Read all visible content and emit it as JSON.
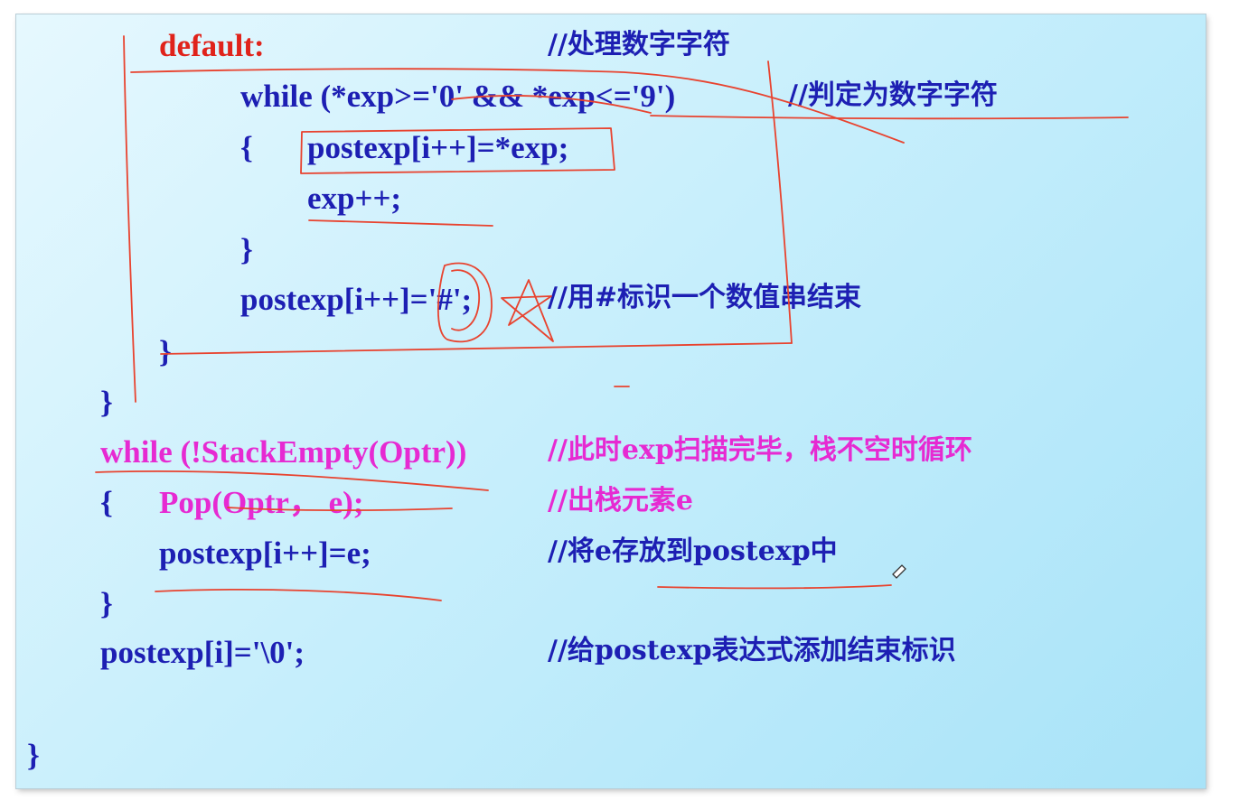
{
  "code_lines": {
    "default_label": "default:",
    "while_digit": "while (*exp>='0' && *exp<='9')",
    "brace_open_1": "{",
    "assign_exp": "postexp[i++]=*exp;",
    "exp_inc": "exp++;",
    "brace_close_1": "}",
    "assign_hash": "postexp[i++]='#';",
    "brace_close_2": "}",
    "brace_close_3": "}",
    "while_stack": "while (!StackEmpty(Optr))",
    "brace_open_2": "{",
    "pop_call": "Pop(Optr， e);",
    "assign_e": "postexp[i++]=e;",
    "brace_close_4": "}",
    "assign_end": "postexp[i]='\\0';",
    "brace_close_5": "}"
  },
  "comments": {
    "c_default": "//处理数字字符",
    "c_while_digit": "//判定为数字字符",
    "c_hash": "//用#标识一个数值串结束",
    "c_while_stack": "//此时exp扫描完毕，栈不空时循环",
    "c_pop": "//出栈元素e",
    "c_assign_e": "//将e存放到postexp中",
    "c_end": "//给postexp表达式添加结束标识"
  },
  "colors": {
    "code_blue": "#1d1fb3",
    "keyword_red": "#e0231b",
    "highlight_magenta": "#e62ad2",
    "annotation_ink": "#e8432f"
  }
}
